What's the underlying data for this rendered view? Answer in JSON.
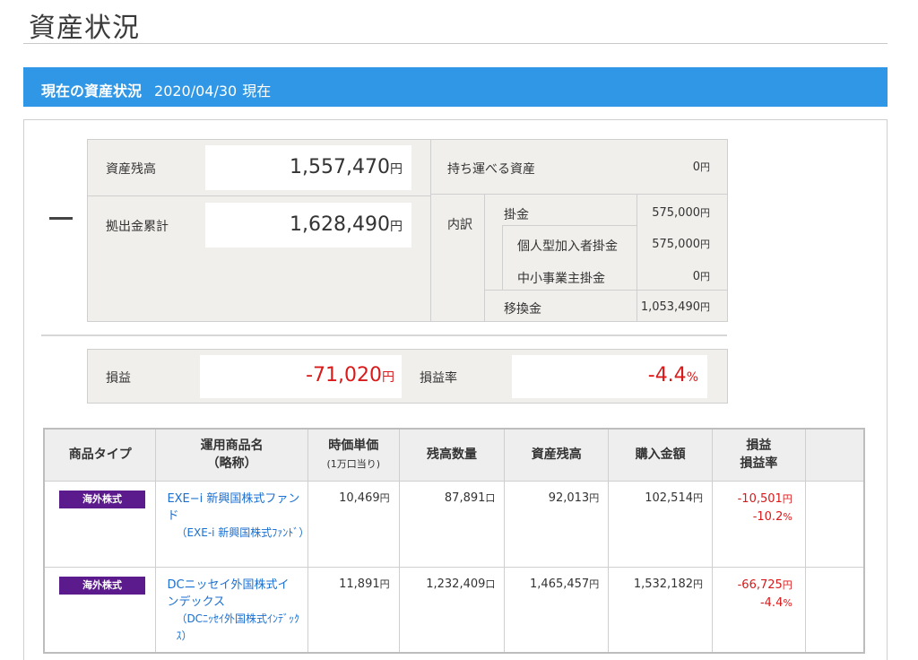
{
  "page": {
    "title": "資産状況"
  },
  "section": {
    "heading": "現在の資産状況",
    "date": "2020/04/30",
    "suffix": "現在"
  },
  "summary": {
    "asset_balance_label": "資産残高",
    "asset_balance_value": "1,557,470",
    "contribution_total_label": "拠出金累計",
    "contribution_total_value": "1,628,490",
    "currency_unit": "円",
    "portable_assets_label": "持ち運べる資産",
    "portable_assets_value": "0",
    "breakdown_label": "内訳",
    "breakdown": {
      "contribution_label": "掛金",
      "contribution_value": "575,000",
      "individual_label": "個人型加入者掛金",
      "individual_value": "575,000",
      "employer_label": "中小事業主掛金",
      "employer_value": "0",
      "transfer_label": "移換金",
      "transfer_value": "1,053,490"
    }
  },
  "profit_loss": {
    "label": "損益",
    "value": "-71,020",
    "unit": "円",
    "rate_label": "損益率",
    "rate_value": "-4.4",
    "rate_unit": "%"
  },
  "table": {
    "headers": {
      "type": "商品タイプ",
      "name_line1": "運用商品名",
      "name_line2": "（略称）",
      "unit_price_line1": "時価単価",
      "unit_price_line2": "(1万口当り)",
      "quantity": "残高数量",
      "balance": "資産残高",
      "purchase": "購入金額",
      "pl_line1": "損益",
      "pl_line2": "損益率"
    },
    "rows": [
      {
        "type": "海外株式",
        "name": "EXE−i 新興国株式ファンド",
        "short_name": "（EXE-i 新興国株式ﾌｧﾝﾄﾞ）",
        "unit_price": "10,469",
        "quantity": "87,891",
        "balance": "92,013",
        "purchase": "102,514",
        "pl": "-10,501",
        "pl_rate": "-10.2"
      },
      {
        "type": "海外株式",
        "name": "DCニッセイ外国株式インデックス",
        "short_name": "（DCﾆｯｾｲ外国株式ｲﾝﾃﾞｯｸｽ）",
        "unit_price": "11,891",
        "quantity": "1,232,409",
        "balance": "1,465,457",
        "purchase": "1,532,182",
        "pl": "-66,725",
        "pl_rate": "-4.4"
      }
    ],
    "yen": "円",
    "kuchi": "口",
    "percent": "%"
  },
  "colors": {
    "section_bar": "#2f97e6",
    "badge": "#5b1b8c",
    "negative": "#d81a1a",
    "link": "#1a6fd0"
  }
}
